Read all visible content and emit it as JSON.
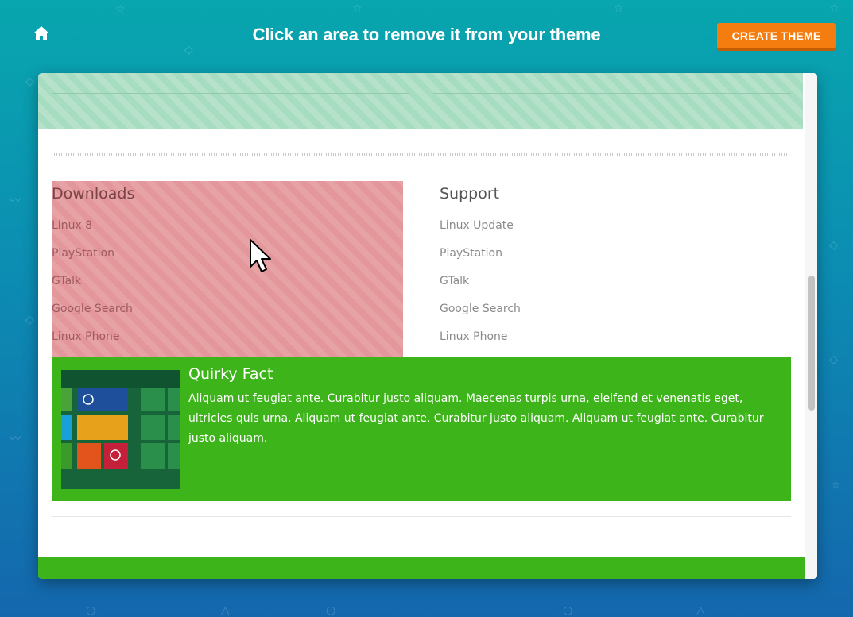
{
  "header": {
    "title": "Click an area to remove it from your theme",
    "create_button": "CREATE THEME"
  },
  "columns": [
    {
      "title": "Downloads",
      "links": [
        "Linux 8",
        "PlayStation",
        "GTalk",
        "Google Search",
        "Linux Phone"
      ],
      "highlighted": true
    },
    {
      "title": "Support",
      "links": [
        "Linux Update",
        "PlayStation",
        "GTalk",
        "Google Search",
        "Linux Phone"
      ],
      "highlighted": false
    }
  ],
  "fact": {
    "title": "Quirky Fact",
    "body": "Aliquam ut feugiat ante. Curabitur justo aliquam. Maecenas turpis urna, eleifend et venenatis eget, ultricies quis urna. Aliquam ut feugiat ante. Curabitur justo aliquam. Aliquam ut feugiat ante. Curabitur justo aliquam."
  },
  "colors": {
    "accent_orange": "#f57c0f",
    "removed_green": "#a6dcc0",
    "removed_red": "#e3979b",
    "fact_green": "#3cb41a"
  },
  "icons": {
    "home": "home-icon",
    "cursor": "mouse-pointer-icon"
  }
}
